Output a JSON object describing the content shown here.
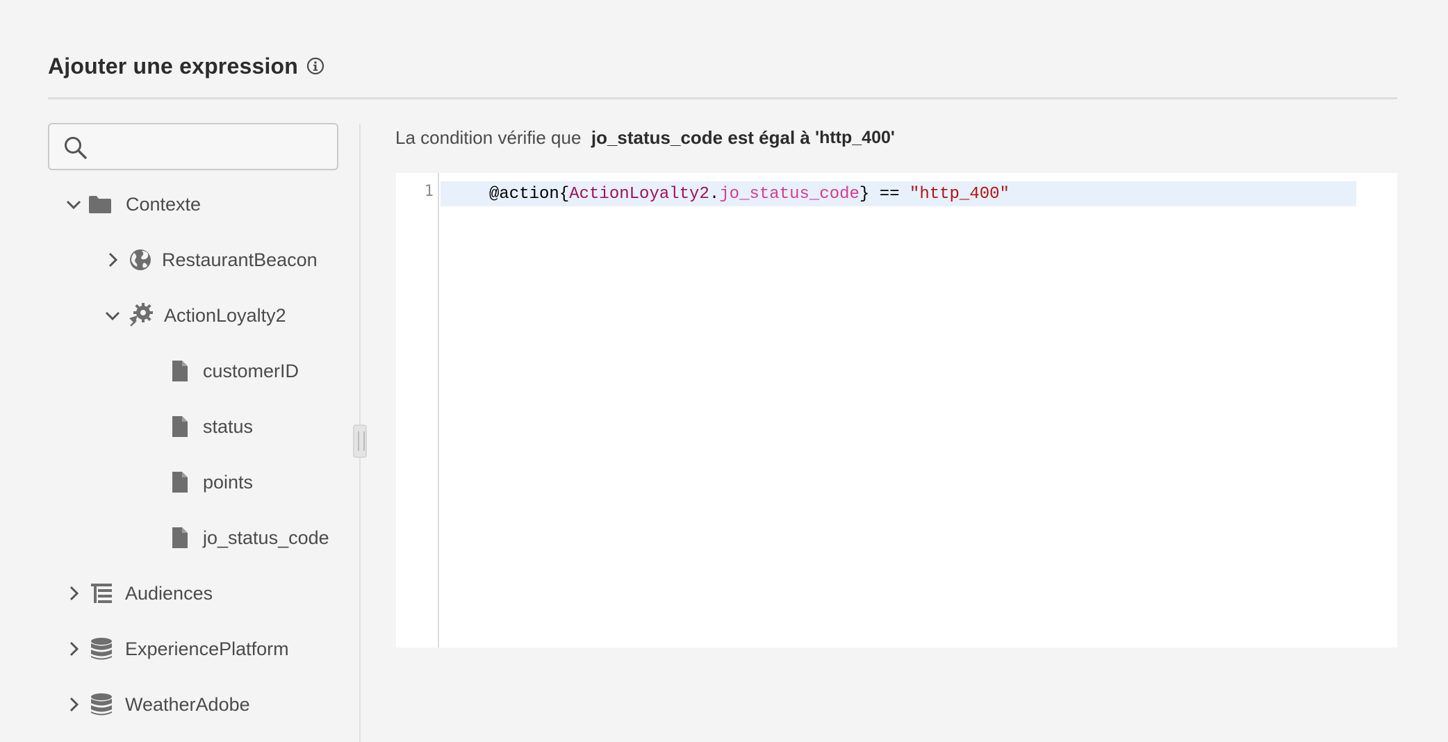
{
  "header": {
    "title": "Ajouter une expression",
    "info_icon": "info-icon"
  },
  "search": {
    "placeholder": "",
    "value": "",
    "icon": "search-icon"
  },
  "tree": {
    "items": [
      {
        "label": "Contexte",
        "icon": "folder-icon",
        "expanded": true
      },
      {
        "label": "RestaurantBeacon",
        "icon": "globe-icon",
        "expanded": false
      },
      {
        "label": "ActionLoyalty2",
        "icon": "action-gear-icon",
        "expanded": true
      },
      {
        "label": "customerID",
        "icon": "file-icon"
      },
      {
        "label": "status",
        "icon": "file-icon"
      },
      {
        "label": "points",
        "icon": "file-icon"
      },
      {
        "label": "jo_status_code",
        "icon": "file-icon"
      },
      {
        "label": "Audiences",
        "icon": "hierarchy-icon",
        "expanded": false
      },
      {
        "label": "ExperiencePlatform",
        "icon": "database-icon",
        "expanded": false
      },
      {
        "label": "WeatherAdobe",
        "icon": "database-icon",
        "expanded": false
      }
    ]
  },
  "condition": {
    "prefix": "La condition vérifie que  ",
    "field": "jo_status_code",
    "operator_text": " est égal à ",
    "value": "'http_400'"
  },
  "editor": {
    "line_number": "1",
    "tokens": {
      "prefix": "@action{",
      "field": "ActionLoyalty2",
      "dot": ".",
      "subfield": "jo_status_code",
      "close": "}",
      "operator": " == ",
      "string": "\"http_400\""
    }
  },
  "colors": {
    "background": "#f4f4f4",
    "field_token": "#a0115e",
    "subfield_token": "#d63a9a",
    "string_token": "#b11414",
    "active_line": "#e8f0fb"
  }
}
